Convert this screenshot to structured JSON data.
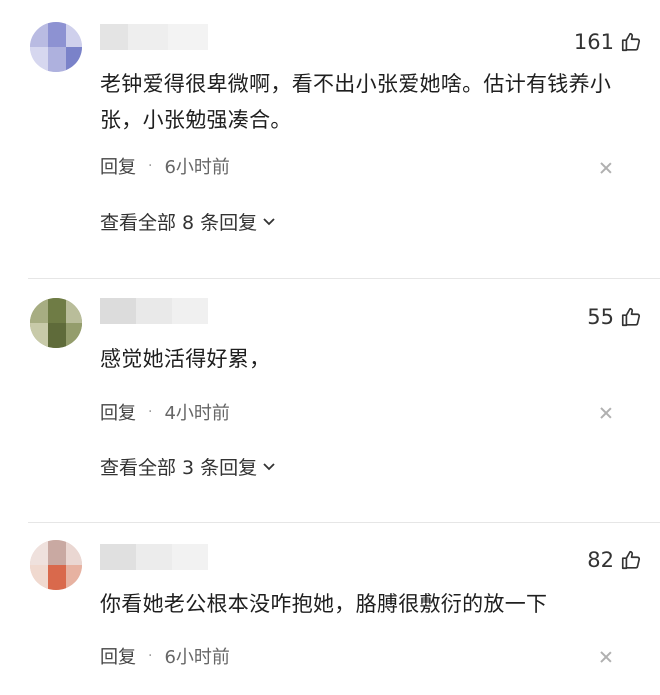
{
  "comments": [
    {
      "likes": "161",
      "text": "老钟爱得很卑微啊，看不出小张爱她啥。估计有钱养小张，小张勉强凑合。",
      "reply_label": "回复",
      "separator": "·",
      "time": "6小时前",
      "view_all_label": "查看全部 8 条回复"
    },
    {
      "likes": "55",
      "text": "感觉她活得好累，",
      "reply_label": "回复",
      "separator": "·",
      "time": "4小时前",
      "view_all_label": "查看全部 3 条回复"
    },
    {
      "likes": "82",
      "text": "你看她老公根本没咋抱她，胳膊很敷衍的放一下",
      "reply_label": "回复",
      "separator": "·",
      "time": "6小时前"
    }
  ],
  "icons": {
    "like": "thumb-up-icon",
    "close": "close-icon",
    "expand": "chevron-down-icon"
  },
  "colors": {
    "text": "#1f1f1f",
    "meta": "#666666",
    "divider": "#e6e6e6"
  }
}
